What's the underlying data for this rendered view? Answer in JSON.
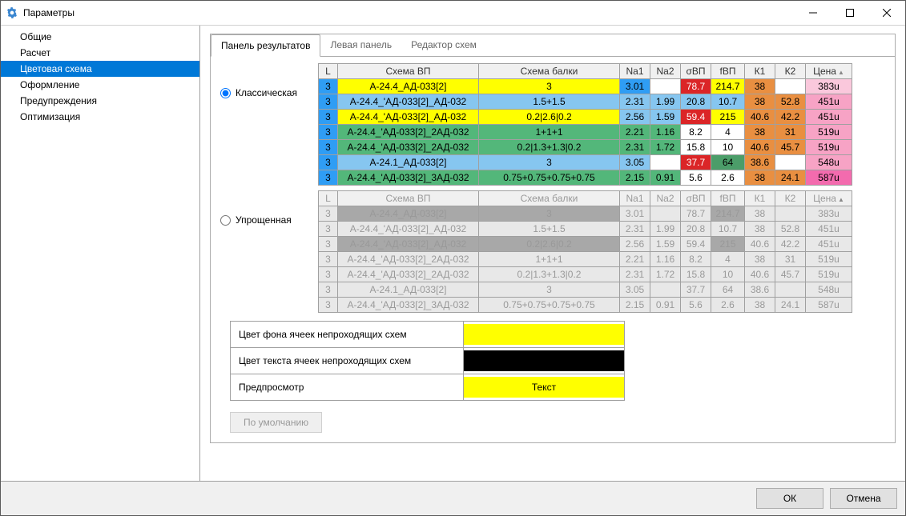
{
  "window": {
    "title": "Параметры"
  },
  "sidebar": {
    "items": [
      {
        "label": "Общие"
      },
      {
        "label": "Расчет"
      },
      {
        "label": "Цветовая схема"
      },
      {
        "label": "Оформление"
      },
      {
        "label": "Предупреждения"
      },
      {
        "label": "Оптимизация"
      }
    ],
    "selected_index": 2
  },
  "tabs": {
    "items": [
      {
        "label": "Панель результатов"
      },
      {
        "label": "Левая панель"
      },
      {
        "label": "Редактор схем"
      }
    ],
    "selected_index": 0
  },
  "radio": {
    "classic": "Классическая",
    "simple": "Упрощенная"
  },
  "headers": {
    "L": "L",
    "scheme_vp": "Схема ВП",
    "scheme_beam": "Схема балки",
    "Na1": "Na1",
    "Na2": "Na2",
    "sVP": "σВП",
    "fVP": "fВП",
    "K1": "К1",
    "K2": "К2",
    "price": "Цена"
  },
  "table1": [
    {
      "L": "3",
      "vp": "А-24.4_АД-033[2]",
      "beam": "3",
      "Na1": "3.01",
      "Na2": "",
      "sVP": "78.7",
      "fVP": "214.7",
      "K1": "38",
      "K2": "",
      "price": "383u",
      "c_L": "c-blue",
      "c_vp": "c-yellow",
      "c_beam": "c-yellow",
      "c_Na1": "c-blue",
      "c_Na2": "c-white",
      "c_sVP": "c-red",
      "c_fVP": "c-yellow",
      "c_K1": "c-orange",
      "c_K2": "c-white",
      "c_price": "c-lpink"
    },
    {
      "L": "3",
      "vp": "А-24.4_'АД-033[2]_АД-032",
      "beam": "1.5+1.5",
      "Na1": "2.31",
      "Na2": "1.99",
      "sVP": "20.8",
      "fVP": "10.7",
      "K1": "38",
      "K2": "52.8",
      "price": "451u",
      "c_L": "c-blue",
      "c_vp": "c-lblue",
      "c_beam": "c-lblue",
      "c_Na1": "c-lblue",
      "c_Na2": "c-lblue",
      "c_sVP": "c-lblue",
      "c_fVP": "c-lblue",
      "c_K1": "c-orange",
      "c_K2": "c-orange",
      "c_price": "c-pink"
    },
    {
      "L": "3",
      "vp": "А-24.4_'АД-033[2]_АД-032",
      "beam": "0.2|2.6|0.2",
      "Na1": "2.56",
      "Na2": "1.59",
      "sVP": "59.4",
      "fVP": "215",
      "K1": "40.6",
      "K2": "42.2",
      "price": "451u",
      "c_L": "c-blue",
      "c_vp": "c-yellow",
      "c_beam": "c-yellow",
      "c_Na1": "c-lblue",
      "c_Na2": "c-lblue",
      "c_sVP": "c-red",
      "c_fVP": "c-yellow",
      "c_K1": "c-orange",
      "c_K2": "c-orange",
      "c_price": "c-pink"
    },
    {
      "L": "3",
      "vp": "А-24.4_'АД-033[2]_2АД-032",
      "beam": "1+1+1",
      "Na1": "2.21",
      "Na2": "1.16",
      "sVP": "8.2",
      "fVP": "4",
      "K1": "38",
      "K2": "31",
      "price": "519u",
      "c_L": "c-blue",
      "c_vp": "c-green",
      "c_beam": "c-green",
      "c_Na1": "c-green",
      "c_Na2": "c-green",
      "c_sVP": "c-white",
      "c_fVP": "c-white",
      "c_K1": "c-orange",
      "c_K2": "c-orange",
      "c_price": "c-pink"
    },
    {
      "L": "3",
      "vp": "А-24.4_'АД-033[2]_2АД-032",
      "beam": "0.2|1.3+1.3|0.2",
      "Na1": "2.31",
      "Na2": "1.72",
      "sVP": "15.8",
      "fVP": "10",
      "K1": "40.6",
      "K2": "45.7",
      "price": "519u",
      "c_L": "c-blue",
      "c_vp": "c-green",
      "c_beam": "c-green",
      "c_Na1": "c-green",
      "c_Na2": "c-green",
      "c_sVP": "c-white",
      "c_fVP": "c-white",
      "c_K1": "c-orange",
      "c_K2": "c-orange",
      "c_price": "c-pink"
    },
    {
      "L": "3",
      "vp": "А-24.1_АД-033[2]",
      "beam": "3",
      "Na1": "3.05",
      "Na2": "",
      "sVP": "37.7",
      "fVP": "64",
      "K1": "38.6",
      "K2": "",
      "price": "548u",
      "c_L": "c-blue",
      "c_vp": "c-lblue",
      "c_beam": "c-lblue",
      "c_Na1": "c-lblue",
      "c_Na2": "c-white",
      "c_sVP": "c-red",
      "c_fVP": "c-dgreen",
      "c_K1": "c-orange",
      "c_K2": "c-white",
      "c_price": "c-pink"
    },
    {
      "L": "3",
      "vp": "А-24.4_'АД-033[2]_3АД-032",
      "beam": "0.75+0.75+0.75+0.75",
      "Na1": "2.15",
      "Na2": "0.91",
      "sVP": "5.6",
      "fVP": "2.6",
      "K1": "38",
      "K2": "24.1",
      "price": "587u",
      "c_L": "c-blue",
      "c_vp": "c-green",
      "c_beam": "c-green",
      "c_Na1": "c-green",
      "c_Na2": "c-green",
      "c_sVP": "c-white",
      "c_fVP": "c-white",
      "c_K1": "c-orange",
      "c_K2": "c-orange",
      "c_price": "c-hotpink"
    }
  ],
  "table2_dark_map": [
    [
      0,
      1,
      1,
      0,
      0,
      0,
      1,
      0,
      0,
      0
    ],
    [
      0,
      0,
      0,
      0,
      0,
      0,
      0,
      0,
      0,
      0
    ],
    [
      0,
      1,
      1,
      0,
      0,
      0,
      1,
      0,
      0,
      0
    ],
    [
      0,
      0,
      0,
      0,
      0,
      0,
      0,
      0,
      0,
      0
    ],
    [
      0,
      0,
      0,
      0,
      0,
      0,
      0,
      0,
      0,
      0
    ],
    [
      0,
      0,
      0,
      0,
      0,
      0,
      0,
      0,
      0,
      0
    ],
    [
      0,
      0,
      0,
      0,
      0,
      0,
      0,
      0,
      0,
      0
    ]
  ],
  "table2": [
    {
      "L": "3",
      "vp": "А-24.4_АД-033[2]",
      "beam": "3",
      "Na1": "3.01",
      "Na2": "",
      "sVP": "78.7",
      "fVP": "214.7",
      "K1": "38",
      "K2": "",
      "price": "383u"
    },
    {
      "L": "3",
      "vp": "А-24.4_'АД-033[2]_АД-032",
      "beam": "1.5+1.5",
      "Na1": "2.31",
      "Na2": "1.99",
      "sVP": "20.8",
      "fVP": "10.7",
      "K1": "38",
      "K2": "52.8",
      "price": "451u"
    },
    {
      "L": "3",
      "vp": "А-24.4_'АД-033[2]_АД-032",
      "beam": "0.2|2.6|0.2",
      "Na1": "2.56",
      "Na2": "1.59",
      "sVP": "59.4",
      "fVP": "215",
      "K1": "40.6",
      "K2": "42.2",
      "price": "451u"
    },
    {
      "L": "3",
      "vp": "А-24.4_'АД-033[2]_2АД-032",
      "beam": "1+1+1",
      "Na1": "2.21",
      "Na2": "1.16",
      "sVP": "8.2",
      "fVP": "4",
      "K1": "38",
      "K2": "31",
      "price": "519u"
    },
    {
      "L": "3",
      "vp": "А-24.4_'АД-033[2]_2АД-032",
      "beam": "0.2|1.3+1.3|0.2",
      "Na1": "2.31",
      "Na2": "1.72",
      "sVP": "15.8",
      "fVP": "10",
      "K1": "40.6",
      "K2": "45.7",
      "price": "519u"
    },
    {
      "L": "3",
      "vp": "А-24.1_АД-033[2]",
      "beam": "3",
      "Na1": "3.05",
      "Na2": "",
      "sVP": "37.7",
      "fVP": "64",
      "K1": "38.6",
      "K2": "",
      "price": "548u"
    },
    {
      "L": "3",
      "vp": "А-24.4_'АД-033[2]_3АД-032",
      "beam": "0.75+0.75+0.75+0.75",
      "Na1": "2.15",
      "Na2": "0.91",
      "sVP": "5.6",
      "fVP": "2.6",
      "K1": "38",
      "K2": "24.1",
      "price": "587u"
    }
  ],
  "settings": {
    "bg_label": "Цвет фона ячеек непроходящих схем",
    "fg_label": "Цвет текста ячеек непроходящих схем",
    "preview_label": "Предпросмотр",
    "preview_text": "Текст",
    "default_btn": "По умолчанию"
  },
  "footer": {
    "ok": "ОК",
    "cancel": "Отмена"
  }
}
